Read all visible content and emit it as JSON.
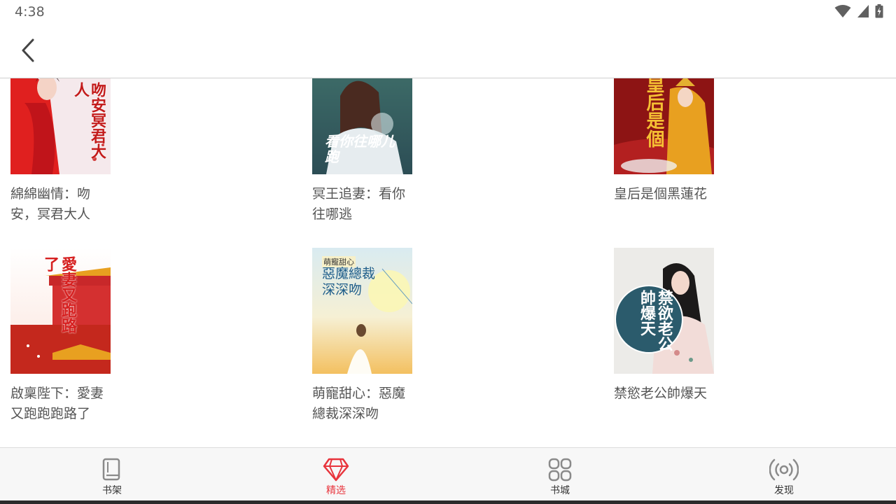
{
  "status": {
    "time": "4:38"
  },
  "books": [
    {
      "title": "綿綿幽情：吻安，冥君大人",
      "cover_text": "吻安冥君大人"
    },
    {
      "title": "冥王追妻：看你往哪逃",
      "cover_text": "看你往哪儿跑"
    },
    {
      "title": "皇后是個黑蓮花",
      "cover_text": "皇后是個"
    },
    {
      "title": "啟稟陛下：愛妻又跑跑跑路了",
      "cover_text": "愛妻又跑路了"
    },
    {
      "title": "萌寵甜心：惡魔總裁深深吻",
      "cover_text": "惡魔總裁深深吻",
      "cover_tag": "萌寵甜心"
    },
    {
      "title": "禁慾老公帥爆天",
      "cover_text": "禁欲老公帥爆天"
    }
  ],
  "tabs": [
    {
      "label": "书架",
      "icon": "book-icon"
    },
    {
      "label": "精选",
      "icon": "diamond-icon",
      "active": true
    },
    {
      "label": "书城",
      "icon": "grid-icon"
    },
    {
      "label": "发现",
      "icon": "broadcast-icon"
    }
  ],
  "colors": {
    "accent": "#e8343c",
    "text": "#555555"
  }
}
